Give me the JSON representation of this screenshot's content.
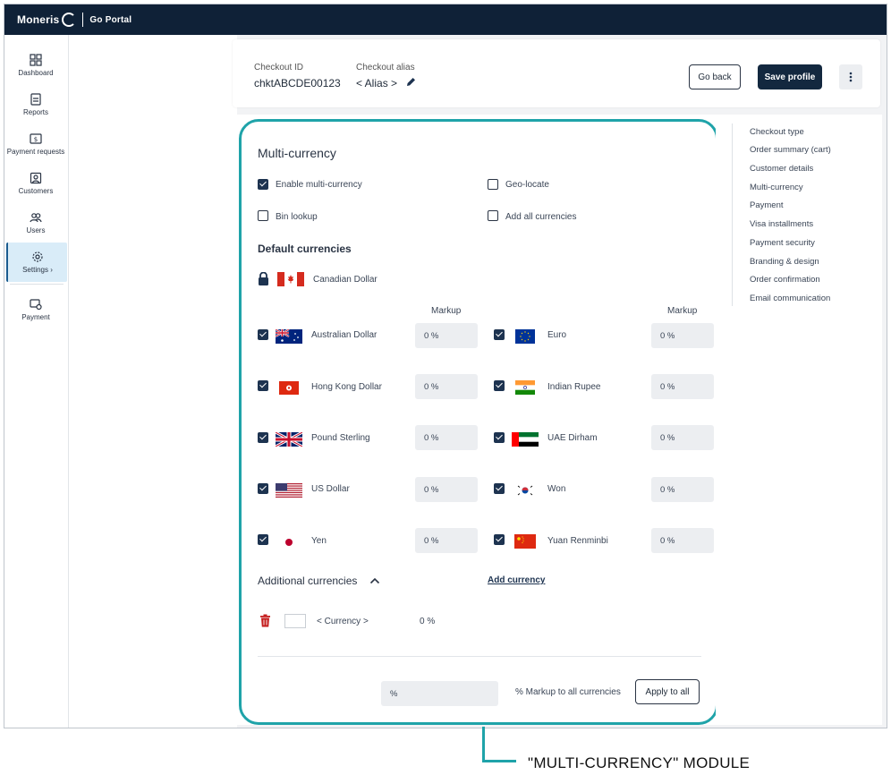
{
  "topbar": {
    "brand": "Moneris",
    "portal_prefix": "Go",
    "portal": "Portal"
  },
  "sidebar": {
    "items": [
      {
        "label": "Dashboard",
        "icon": "dashboard-icon"
      },
      {
        "label": "Reports",
        "icon": "reports-icon"
      },
      {
        "label": "Payment requests",
        "icon": "payment-requests-icon"
      },
      {
        "label": "Customers",
        "icon": "customers-icon"
      },
      {
        "label": "Users",
        "icon": "users-icon"
      },
      {
        "label": "Settings ›",
        "icon": "gear-icon",
        "active": true
      },
      {
        "label": "Payment",
        "icon": "payment-icon"
      }
    ]
  },
  "header": {
    "checkout_id_label": "Checkout ID",
    "checkout_id": "chktABCDE00123",
    "alias_label": "Checkout alias",
    "alias_value": "< Alias >",
    "go_back": "Go back",
    "save_profile": "Save profile"
  },
  "module": {
    "title": "Multi-currency",
    "options": {
      "enable_multi_currency": {
        "label": "Enable multi-currency",
        "checked": true
      },
      "geo_locate": {
        "label": "Geo-locate",
        "checked": false
      },
      "bin_lookup": {
        "label": "Bin lookup",
        "checked": false
      },
      "add_all_currencies": {
        "label": "Add all currencies",
        "checked": false
      }
    },
    "default_currencies_title": "Default currencies",
    "locked_currency": "Canadian Dollar",
    "markup_header": "Markup",
    "currencies": [
      {
        "name": "Australian Dollar",
        "markup": "0 %",
        "checked": true,
        "flag": "au"
      },
      {
        "name": "Euro",
        "markup": "0 %",
        "checked": true,
        "flag": "eu"
      },
      {
        "name": "Hong Kong Dollar",
        "markup": "0 %",
        "checked": true,
        "flag": "hk"
      },
      {
        "name": "Indian Rupee",
        "markup": "0 %",
        "checked": true,
        "flag": "in"
      },
      {
        "name": "Pound Sterling",
        "markup": "0 %",
        "checked": true,
        "flag": "gb"
      },
      {
        "name": "UAE Dirham",
        "markup": "0 %",
        "checked": true,
        "flag": "ae"
      },
      {
        "name": "US Dollar",
        "markup": "0 %",
        "checked": true,
        "flag": "us"
      },
      {
        "name": "Won",
        "markup": "0 %",
        "checked": true,
        "flag": "kr"
      },
      {
        "name": "Yen",
        "markup": "0 %",
        "checked": true,
        "flag": "jp"
      },
      {
        "name": "Yuan Renminbi",
        "markup": "0 %",
        "checked": true,
        "flag": "cn"
      }
    ],
    "additional_title": "Additional currencies",
    "add_currency": "Add currency",
    "additional_row": {
      "currency": "< Currency >",
      "markup": "0 %"
    },
    "apply_all": {
      "placeholder": "%",
      "label": "% Markup to all currencies",
      "button": "Apply to all"
    }
  },
  "right_nav": [
    "Checkout type",
    "Order summary (cart)",
    "Customer details",
    "Multi-currency",
    "Payment",
    "Visa installments",
    "Payment security",
    "Branding & design",
    "Order confirmation",
    "Email communication"
  ],
  "caption": "\"MULTI-CURRENCY\" MODULE",
  "colors": {
    "navy": "#0f2137",
    "teal": "#1fa3a9",
    "active_nav": "#d9ecf8"
  }
}
